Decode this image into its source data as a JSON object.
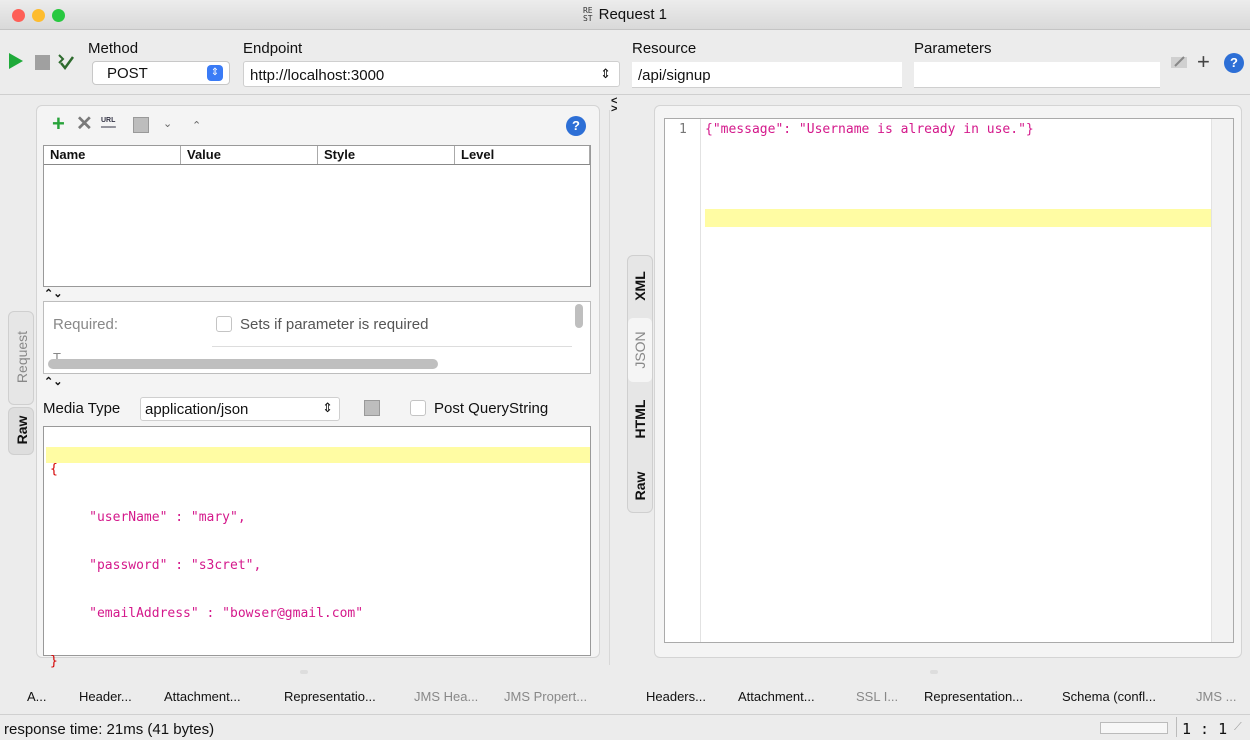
{
  "window": {
    "title": "Request 1",
    "rest_glyph_top": "RE",
    "rest_glyph_bottom": "ST"
  },
  "toolbar": {
    "method_label": "Method",
    "method_value": "POST",
    "endpoint_label": "Endpoint",
    "endpoint_value": "http://localhost:3000",
    "resource_label": "Resource",
    "resource_value": "/api/signup",
    "parameters_label": "Parameters",
    "parameters_value": ""
  },
  "params_table": {
    "columns": [
      "Name",
      "Value",
      "Style",
      "Level"
    ],
    "rows": []
  },
  "param_detail": {
    "required_label": "Required:",
    "required_checkbox_label": "Sets if parameter is required",
    "partial_label": "T..."
  },
  "media": {
    "label": "Media Type",
    "value": "application/json",
    "post_qs_label": "Post QueryString"
  },
  "request_body": {
    "lines": [
      "{",
      "     \"userName\" : \"mary\",",
      "     \"password\" : \"s3cret\",",
      "     \"emailAddress\" : \"bowser@gmail.com\"",
      "}"
    ]
  },
  "request_side_tabs": [
    "Request",
    "Raw"
  ],
  "response": {
    "line_number": "1",
    "text": "{\"message\": \"Username is already in use.\"}",
    "side_tabs": [
      "XML",
      "JSON",
      "HTML",
      "Raw"
    ]
  },
  "request_bottom_tabs": [
    "A...",
    "Header...",
    "Attachment...",
    "Representatio...",
    "JMS Hea...",
    "JMS Propert..."
  ],
  "response_bottom_tabs": [
    "Headers...",
    "Attachment...",
    "SSL I...",
    "Representation...",
    "Schema (confl...",
    "JMS ..."
  ],
  "status": {
    "text": "response time: 21ms (41 bytes)",
    "position": "1 : 1"
  },
  "colors": {
    "accent": "#3a7bf6",
    "json_string": "#d4188b",
    "json_brace": "#d40000",
    "highlight": "#fffca3",
    "play": "#1faa3a"
  }
}
